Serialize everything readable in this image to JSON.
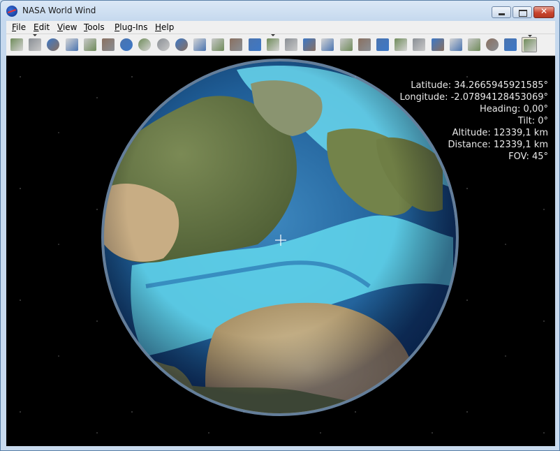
{
  "window": {
    "title": "NASA World Wind"
  },
  "menu": [
    {
      "label": "File",
      "mnemonic": "F",
      "rest": "ile"
    },
    {
      "label": "Edit",
      "mnemonic": "E",
      "rest": "dit"
    },
    {
      "label": "View",
      "mnemonic": "V",
      "rest": "iew"
    },
    {
      "label": "Tools",
      "mnemonic": "T",
      "rest": "ools"
    },
    {
      "label": "Plug-Ins",
      "mnemonic": "P",
      "rest": "lug-Ins"
    },
    {
      "label": "Help",
      "mnemonic": "H",
      "rest": "elp"
    }
  ],
  "toolbar": {
    "icons": [
      "world-layers-icon",
      "latlon-grid-icon",
      "globe-icon",
      "compass-icon",
      "placenames-icon",
      "search-icon",
      "earth-icon",
      "moon-icon",
      "mars-icon",
      "jupiter-icon",
      "boundaries-icon",
      "landsat-icon",
      "modis-icon",
      "rapid-fire-icon",
      "animated-earth-icon",
      "map-icon",
      "satellite-icon",
      "terrain-icon",
      "topo-icon",
      "usgs-icon",
      "urban-icon",
      "scale-icon",
      "satellite-tracker-icon",
      "measure-icon",
      "flag-icon",
      "layer-manager-icon",
      "sphere-icon",
      "cloud-icon",
      "active-plugin-icon"
    ],
    "colors": {
      "accent": "#5a7fa6",
      "icon_palette": [
        "#6f8b5a",
        "#8a8f95",
        "#3d78c6",
        "#d5d5d5",
        "#c9c9c9",
        "#8a7060",
        "#4a74b0"
      ]
    }
  },
  "readout": {
    "latitude": "Latitude: 34.2665945921585°",
    "longitude": "Longitude: -2.07894128453069°",
    "heading": "Heading: 0,00°",
    "tilt": "Tilt: 0°",
    "altitude": "Altitude: 12339,1 km",
    "distance": "Distance: 12339,1 km",
    "fov": "FOV: 45°"
  },
  "colors": {
    "ocean_deep": "#1f5d96",
    "ocean_shallow": "#5fd3ea",
    "land": "#6b7a4a",
    "desert": "#b9a37a",
    "space": "#000000"
  }
}
